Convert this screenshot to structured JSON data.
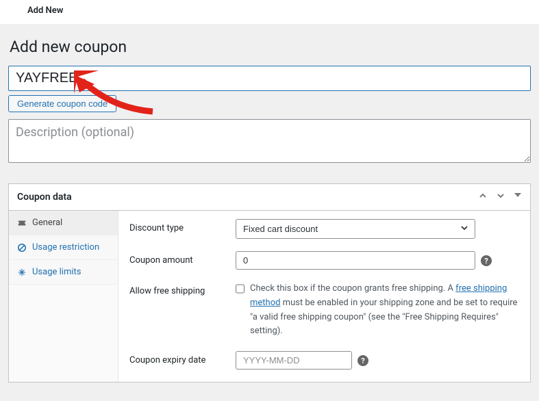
{
  "topbar": {
    "label": "Add New"
  },
  "page": {
    "title": "Add new coupon"
  },
  "coupon_code": {
    "value": "YAYFREE"
  },
  "generate_btn": {
    "label": "Generate coupon code"
  },
  "description": {
    "placeholder": "Description (optional)",
    "value": ""
  },
  "panel": {
    "title": "Coupon data"
  },
  "tabs": [
    {
      "label": "General"
    },
    {
      "label": "Usage restriction"
    },
    {
      "label": "Usage limits"
    }
  ],
  "fields": {
    "discount_type": {
      "label": "Discount type",
      "value": "Fixed cart discount"
    },
    "coupon_amount": {
      "label": "Coupon amount",
      "value": "0"
    },
    "free_shipping": {
      "label": "Allow free shipping",
      "desc_prefix": "Check this box if the coupon grants free shipping. A ",
      "desc_link": "free shipping method",
      "desc_suffix": " must be enabled in your shipping zone and be set to require \"a valid free shipping coupon\" (see the \"Free Shipping Requires\" setting)."
    },
    "expiry": {
      "label": "Coupon expiry date",
      "placeholder": "YYYY-MM-DD",
      "value": ""
    }
  }
}
